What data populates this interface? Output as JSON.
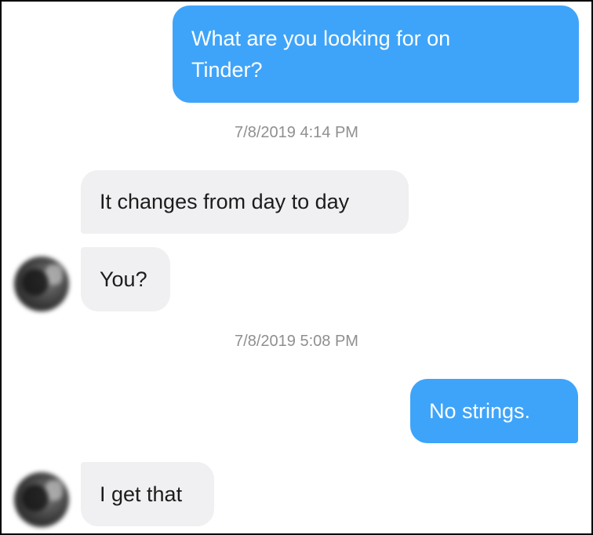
{
  "messages": [
    {
      "type": "sent",
      "text_line1": "What are you looking for on",
      "text_line2": "Tinder?"
    },
    {
      "type": "timestamp",
      "text": "7/8/2019 4:14 PM"
    },
    {
      "type": "received",
      "text": "It changes from day to day"
    },
    {
      "type": "received",
      "text": "You?"
    },
    {
      "type": "timestamp",
      "text": "7/8/2019 5:08 PM"
    },
    {
      "type": "sent",
      "text": "No strings."
    },
    {
      "type": "received",
      "text": "I get that"
    }
  ],
  "colors": {
    "sent_bubble": "#3ea4f9",
    "received_bubble": "#f0f0f2",
    "timestamp_text": "#8f8f8f"
  },
  "icons": {
    "avatar": "contact-avatar-blurred"
  }
}
